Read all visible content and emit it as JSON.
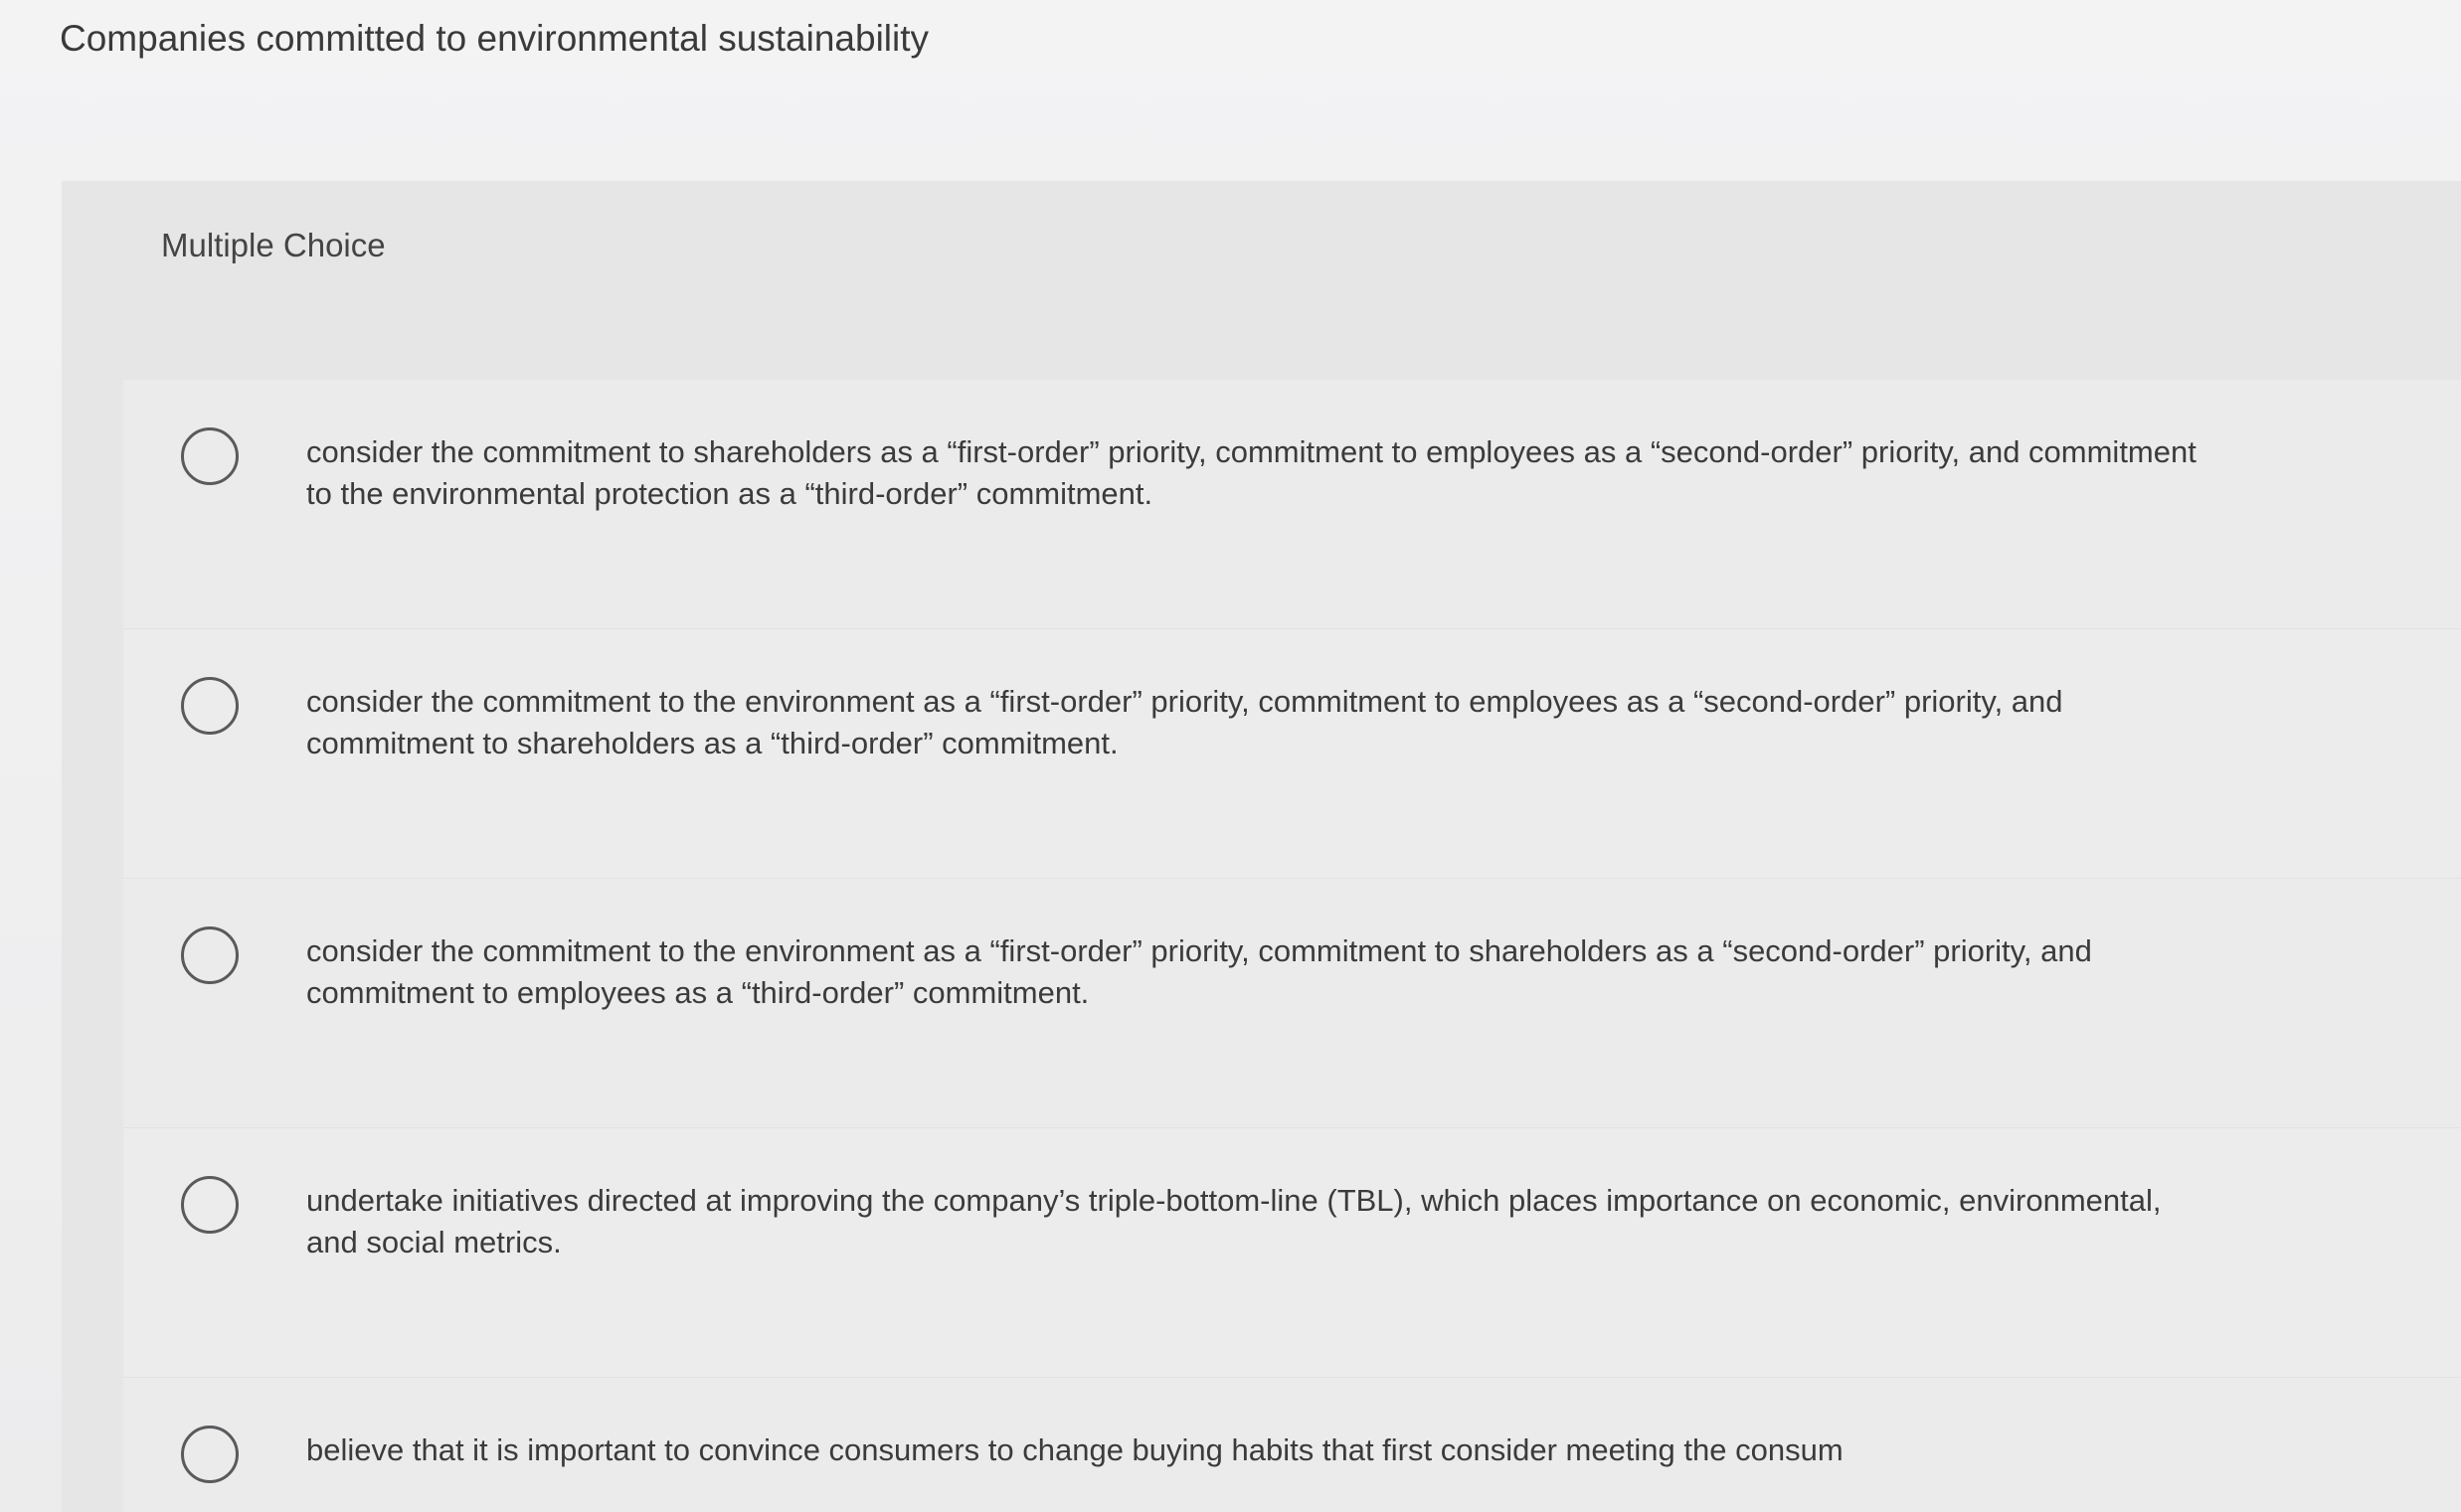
{
  "question": {
    "title": "Companies committed to environmental sustainability",
    "type_label": "Multiple Choice"
  },
  "choices": [
    {
      "text": "consider the commitment to shareholders as a “first-order” priority, commitment to employees as a “second-order” priority, and commitment to the environmental protection as a “third-order” commitment."
    },
    {
      "text": "consider the commitment to the environment as a “first-order” priority, commitment to employees as a “second-order” priority, and commitment to shareholders as a “third-order” commitment."
    },
    {
      "text": "consider the commitment to the environment as a “first-order” priority, commitment to shareholders as a “second-order” priority, and commitment to employees as a “third-order” commitment."
    },
    {
      "text": "undertake initiatives directed at improving the company’s triple-bottom-line (TBL), which places importance on economic, environmental, and social metrics."
    },
    {
      "text": "believe that it is important to convince consumers to change buying habits that first consider meeting the consum"
    }
  ]
}
